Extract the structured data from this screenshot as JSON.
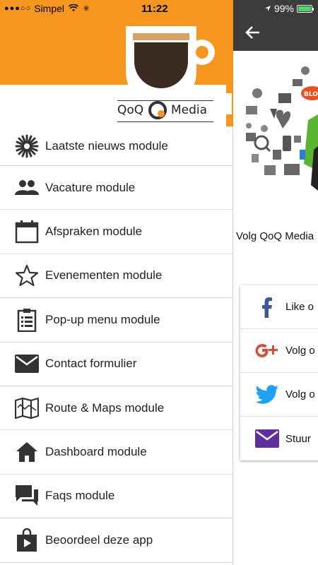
{
  "status_bar": {
    "signal": "●●●○○",
    "carrier": "Simpel",
    "time": "11:22",
    "battery_text": "99%",
    "battery_level": 0.99
  },
  "header": {
    "logo_left": "QoQ",
    "logo_right": "Media",
    "brand_color": "#f7961e"
  },
  "menu": {
    "items": [
      {
        "label": "Laatste nieuws module",
        "icon": "starburst-icon"
      },
      {
        "label": "Vacature module",
        "icon": "people-icon"
      },
      {
        "label": "Afspraken module",
        "icon": "calendar-icon"
      },
      {
        "label": "Evenementen module",
        "icon": "star-icon"
      },
      {
        "label": "Pop-up menu module",
        "icon": "clipboard-icon"
      },
      {
        "label": "Contact formulier",
        "icon": "mail-icon"
      },
      {
        "label": "Route & Maps module",
        "icon": "map-icon"
      },
      {
        "label": "Dashboard module",
        "icon": "home-icon"
      },
      {
        "label": "Faqs module",
        "icon": "chat-icon"
      },
      {
        "label": "Beoordeel deze app",
        "icon": "shopping-bag-icon"
      }
    ]
  },
  "pane": {
    "follow_title": "Volg QoQ Media",
    "collage_badge": "BLOG",
    "social": [
      {
        "label": "Like o",
        "icon": "facebook-icon",
        "color": "#3b5998"
      },
      {
        "label": "Volg o",
        "icon": "google-plus-icon",
        "color": "#dd4b39"
      },
      {
        "label": "Volg o",
        "icon": "twitter-icon",
        "color": "#1da1f2"
      },
      {
        "label": "Stuur",
        "icon": "email-icon",
        "color": "#5f2f9e"
      }
    ]
  }
}
